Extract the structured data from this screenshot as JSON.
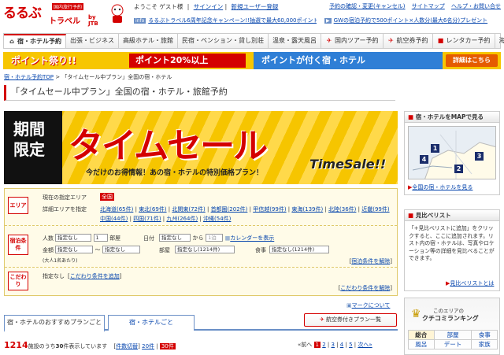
{
  "header": {
    "logo_text": "るるぶ",
    "logo_sub": "トラベル",
    "logo_tag": "国内旅行予約",
    "logo_by": "by JTB",
    "welcome": "ようこそ ゲスト様",
    "signin": "サインイン",
    "register": "新規ユーザー登録",
    "links": [
      "予約の確認・変更(キャンセル)",
      "サイトマップ",
      "ヘルプ・お問い合せ"
    ],
    "info_badge": "info",
    "info1": "るるぶトラベル6周年記念キャンペーン!!抽選で最大60,000ポイントなど",
    "info2": "GWの宿泊予約で500ポイント×人数分(最大6名分)プレゼント"
  },
  "nav": {
    "tabs": [
      "宿・ホテル予約",
      "出張・ビジネス",
      "高級ホテル・旅館",
      "民宿・ペンション・貸し別荘",
      "温泉・露天風呂",
      "国内ツアー予約",
      "航空券予約",
      "レンタカー予約",
      "海外"
    ]
  },
  "banner": {
    "b1": "ポイント祭り!!",
    "b2": "ポイント20%以上",
    "b3": "ポイントが付く宿・ホテル",
    "b4": "詳細はこちら"
  },
  "breadcrumb": {
    "home": "宿・ホテル予約TOP",
    "sep": ">",
    "current": "「タイムセール中プラン」全国の宿・ホテル"
  },
  "page_title": "「タイムセール中プラン」全国の宿・ホテル・旅館予約",
  "hero": {
    "limited": "期間限定",
    "main": "タイムセール",
    "sub": "今だけのお得情報！あの宿・ホテルの特別価格プラン！",
    "eng": "TimeSale!!"
  },
  "search": {
    "area_label": "エリア",
    "area_current_label": "現在の指定エリア",
    "area_current": "全国",
    "area_detail_label": "詳細エリアを指定",
    "areas_row1": [
      "北海道(65件)",
      "東北(69件)",
      "北関東(72件)",
      "首都圏(202件)",
      "甲信越(99件)",
      "東海(139件)",
      "北陸(36件)",
      "近畿(99件)"
    ],
    "areas_row2": [
      "中国(44件)",
      "四国(71件)",
      "九州(264件)",
      "沖縄(54件)"
    ],
    "cond_label": "宿泊条件",
    "people_label": "人数",
    "people_value": "指定なし",
    "rooms_value": "1",
    "rooms_unit": "部屋",
    "date_label": "日付",
    "date_value": "指定なし",
    "date_from": "から",
    "nights_value": "1泊",
    "calendar_link": "カレンダーを表示",
    "price_label": "金額",
    "price_min": "指定なし",
    "price_tilde": "〜",
    "price_max": "指定なし",
    "per_adult": "(大人1名あたり)",
    "room_label": "部屋",
    "room_value": "指定なし(1214件)",
    "meal_label": "食事",
    "meal_value": "指定なし(1214件)",
    "clear_cond": "宿泊条件を解除",
    "kodawari_label": "こだわり",
    "kodawari_current": "指定なし",
    "kodawari_add": "こだわり条件を追加",
    "clear_kodawari": "こだわり条件を解除"
  },
  "tabs": {
    "t1": "宿・ホテルのおすすめプランごと",
    "t2": "宿・ホテルごと",
    "plan_btn": "航空券付きプラン一覧",
    "mark": "マークについて"
  },
  "results": {
    "count": "1214",
    "text1": "施設のうち",
    "shown": "30",
    "text2": "件表示しています",
    "switch_label": "件数切替",
    "opt20": "20件",
    "opt30": "30件"
  },
  "pager": {
    "prev": "前へ",
    "pages": [
      "1",
      "2",
      "3",
      "4",
      "5"
    ],
    "next": "次へ"
  },
  "side": {
    "map_title": "宿・ホテルをMAPで見る",
    "map_badges": [
      "1",
      "2",
      "3",
      "4"
    ],
    "map_link": "全国の宿・ホテルを見る",
    "compare_title": "見比べリスト",
    "compare_text": "「+見比べリストに追加」をクリックすると、ここに追加されます。リスト内の宿・ホテルは、写真やロケーション等の詳細を見比べることができます。",
    "compare_link": "見比べリストとは",
    "rank_sub": "このエリアの",
    "rank_title": "クチコミランキング",
    "rank_items": [
      "総合",
      "部屋",
      "食事",
      "風呂",
      "デート",
      "家族"
    ]
  },
  "colors": {
    "brand": "#d40000",
    "accent": "#f6c500",
    "blue": "#2f7fd6"
  }
}
